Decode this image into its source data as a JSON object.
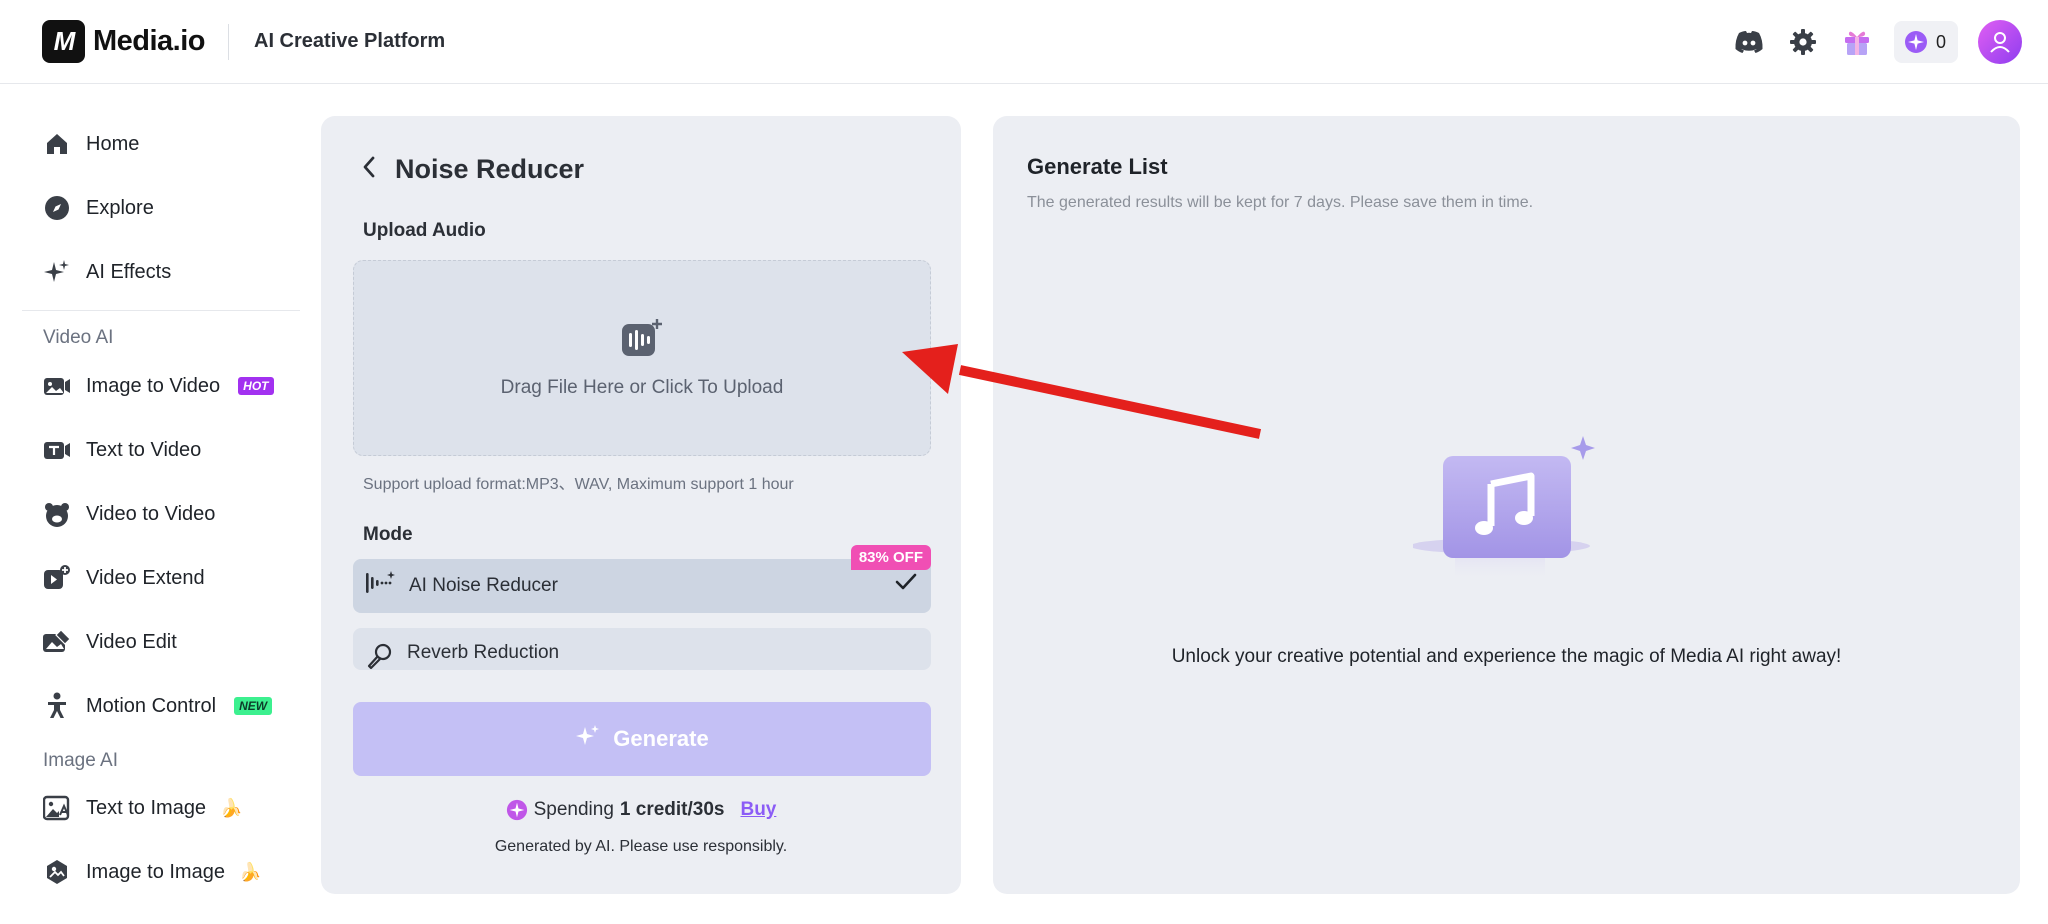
{
  "header": {
    "brand": "Media.io",
    "logo_mark": "M",
    "platform": "AI Creative Platform",
    "credits": "0",
    "icons": [
      "discord-icon",
      "gear-icon",
      "gift-icon",
      "credit-icon",
      "avatar-icon"
    ]
  },
  "sidebar": {
    "top_items": [
      {
        "label": "Home",
        "icon": "home-icon"
      },
      {
        "label": "Explore",
        "icon": "compass-icon"
      },
      {
        "label": "AI Effects",
        "icon": "sparkle-icon"
      }
    ],
    "video_section": "Video AI",
    "video_items": [
      {
        "label": "Image to Video",
        "badge": "HOT"
      },
      {
        "label": "Text to Video"
      },
      {
        "label": "Video to Video"
      },
      {
        "label": "Video Extend"
      },
      {
        "label": "Video Edit"
      },
      {
        "label": "Motion Control",
        "badge": "NEW"
      }
    ],
    "image_section": "Image AI",
    "image_items": [
      {
        "label": "Text to Image",
        "emoji": "🍌"
      },
      {
        "label": "Image to Image",
        "emoji": "🍌"
      }
    ]
  },
  "tool": {
    "title": "Noise Reducer",
    "upload_label": "Upload Audio",
    "upload_text": "Drag File Here or Click To Upload",
    "support_text": "Support upload format:MP3、WAV, Maximum support 1 hour",
    "mode_label": "Mode",
    "modes": [
      {
        "label": "AI Noise Reducer",
        "badge": "83% OFF",
        "selected": true
      },
      {
        "label": "Reverb Reduction",
        "selected": false
      }
    ],
    "generate_label": "Generate",
    "spend_prefix": "Spending",
    "spend_value": "1 credit/30s",
    "buy_label": "Buy",
    "ai_note": "Generated by AI. Please use responsibly."
  },
  "generate_list": {
    "title": "Generate List",
    "subtitle": "The generated results will be kept for 7 days. Please save them in time.",
    "empty_text": "Unlock your creative potential and experience the magic of Media AI right away!"
  },
  "colors": {
    "accent": "#8b5cf6",
    "generate_disabled": "#c4c0f5",
    "badge_off": "#f04fb4",
    "annotation_arrow": "#e4201c"
  }
}
